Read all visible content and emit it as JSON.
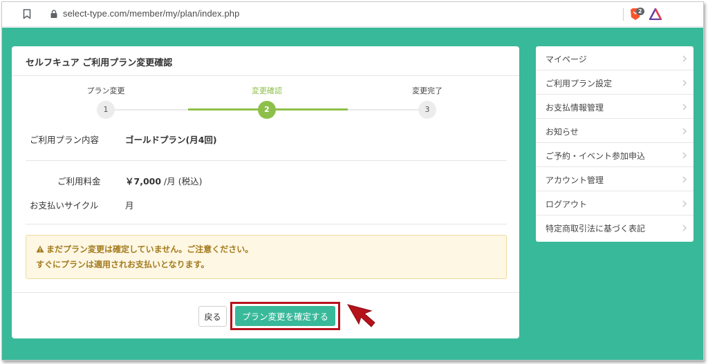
{
  "browser": {
    "url": "select-type.com/member/my/plan/index.php",
    "brave_count": "2"
  },
  "card": {
    "title": "セルフキュア ご利用プラン変更確認",
    "steps": [
      {
        "number": "1",
        "label": "プラン変更",
        "active": false
      },
      {
        "number": "2",
        "label": "変更確認",
        "active": true
      },
      {
        "number": "3",
        "label": "変更完了",
        "active": false
      }
    ],
    "plan": {
      "label": "ご利用プラン内容",
      "value": "ゴールドプラン(月4回)"
    },
    "fee": {
      "label": "ご利用料金",
      "amount": "￥7,000",
      "unit": "/月 (税込)"
    },
    "cycle": {
      "label": "お支払いサイクル",
      "value": "月"
    },
    "alert": {
      "line1": "まだプラン変更は確定していません。ご注意ください。",
      "line2": "すぐにプランは適用されお支払いとなります。"
    },
    "back_label": "戻る",
    "confirm_label": "プラン変更を確定する"
  },
  "sidebar": {
    "items": [
      {
        "label": "マイページ"
      },
      {
        "label": "ご利用プラン設定"
      },
      {
        "label": "お支払情報管理"
      },
      {
        "label": "お知らせ"
      },
      {
        "label": "ご予約・イベント参加申込"
      },
      {
        "label": "アカウント管理"
      },
      {
        "label": "ログアウト"
      },
      {
        "label": "特定商取引法に基づく表記"
      }
    ]
  },
  "colors": {
    "page_background": "#38b99a",
    "step_active": "#8dc04a",
    "confirm_button": "#38b99a",
    "highlight_border": "#b5121b",
    "alert_text": "#a47a1e"
  },
  "icons": [
    "bookmark-icon",
    "lock-icon",
    "brave-shield-icon",
    "brave-rewards-icon",
    "warning-icon",
    "chevron-right-icon",
    "pointer-arrow-icon"
  ]
}
